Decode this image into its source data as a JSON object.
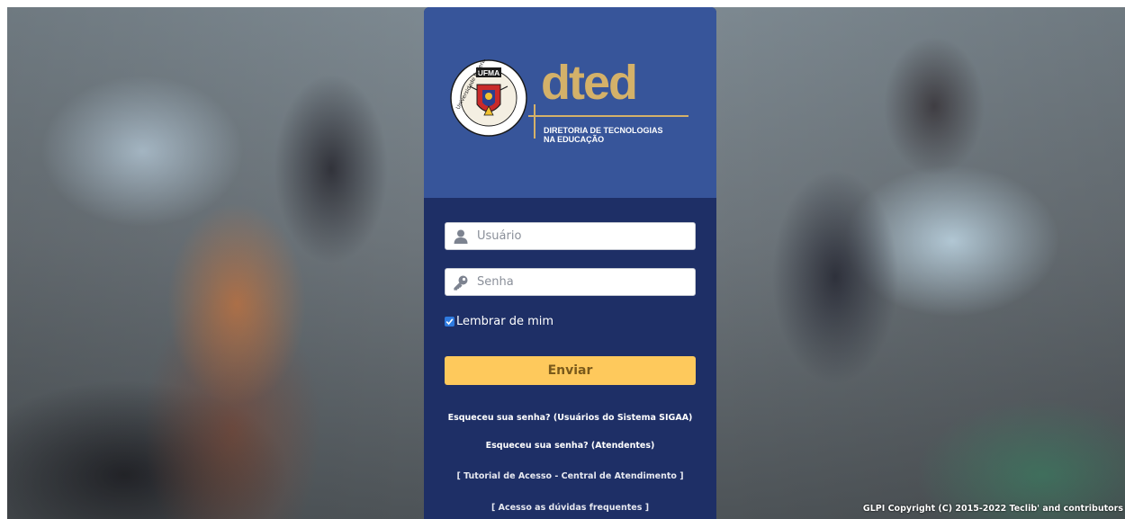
{
  "header": {
    "seal_acronym": "UFMA",
    "seal_ring_text": "Universidade Federal do Maranhão",
    "brand_name": "dted",
    "brand_subtitle_line1": "DIRETORIA DE TECNOLOGIAS",
    "brand_subtitle_line2": "NA EDUCAÇÃO"
  },
  "form": {
    "username_placeholder": "Usuário",
    "password_placeholder": "Senha",
    "remember_label": "Lembrar de mim",
    "remember_checked": true,
    "submit_label": "Enviar"
  },
  "links": {
    "forgot_sigaa": "Esqueceu sua senha? (Usuários do Sistema SIGAA)",
    "forgot_attendants": "Esqueceu sua senha? (Atendentes)",
    "tutorial": "[ Tutorial de Acesso - Central de Atendimento ]",
    "faq": "[ Acesso as dúvidas frequentes ]"
  },
  "footer": {
    "copyright": "GLPI Copyright (C) 2015-2022 Teclib' and contributors"
  },
  "colors": {
    "card_bg": "#1e2f66",
    "header_bg": "#37559a",
    "brand_gold": "#d4b169",
    "submit_bg": "#fec95c",
    "checkbox_blue": "#2f7be0"
  },
  "icons": {
    "username": "user-icon",
    "password": "key-icon",
    "remember": "checkmark-icon"
  }
}
